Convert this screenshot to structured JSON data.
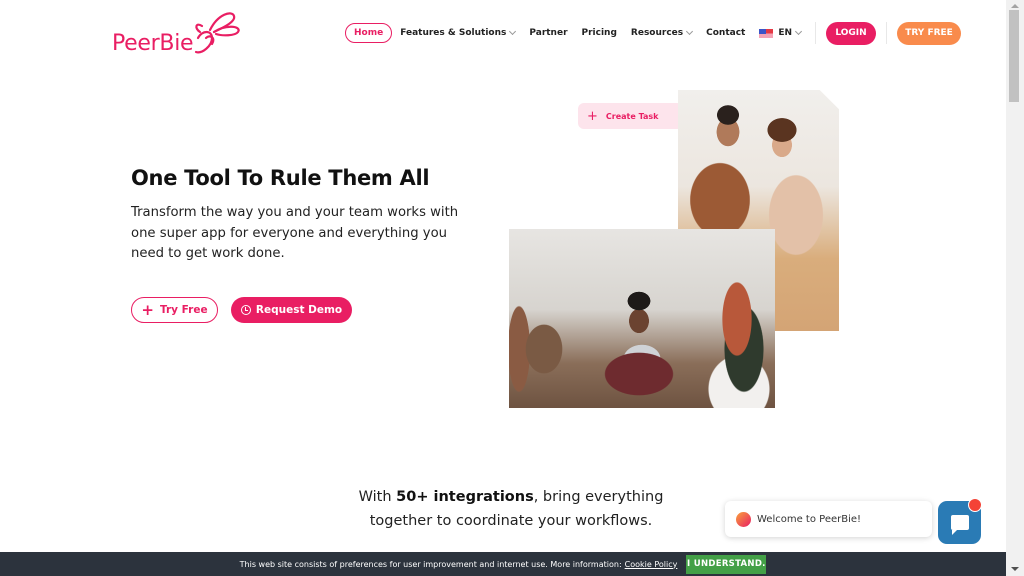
{
  "brand": {
    "name": "PeerBie",
    "primary_color": "#e91e63",
    "accent_orange": "#f98b4c"
  },
  "nav": {
    "items": [
      {
        "label": "Home",
        "active": true,
        "has_dropdown": false
      },
      {
        "label": "Features & Solutions",
        "active": false,
        "has_dropdown": true
      },
      {
        "label": "Partner",
        "active": false,
        "has_dropdown": false
      },
      {
        "label": "Pricing",
        "active": false,
        "has_dropdown": false
      },
      {
        "label": "Resources",
        "active": false,
        "has_dropdown": true
      },
      {
        "label": "Contact",
        "active": false,
        "has_dropdown": false
      }
    ],
    "language": {
      "label": "EN",
      "icon": "us-flag-icon"
    },
    "login_label": "LOGIN",
    "try_free_label": "TRY FREE"
  },
  "hero": {
    "title": "One Tool To Rule Them All",
    "description": "Transform the way you and your team works with one super app for everyone and everything you need to get work done.",
    "try_free_label": "Try Free",
    "request_demo_label": "Request Demo",
    "create_task_label": "Create Task"
  },
  "integrations": {
    "prefix": "With ",
    "highlight": "50+ integrations",
    "suffix": ", bring everything together to coordinate your workflows."
  },
  "chat": {
    "welcome_text": "Welcome to PeerBie!",
    "has_notification": true
  },
  "cookie_bar": {
    "text": "This web site consists of preferences for user improvement and internet use. More information:",
    "link_label": "Cookie Policy",
    "button_label": "I UNDERSTAND.",
    "button_color": "#43a047"
  }
}
